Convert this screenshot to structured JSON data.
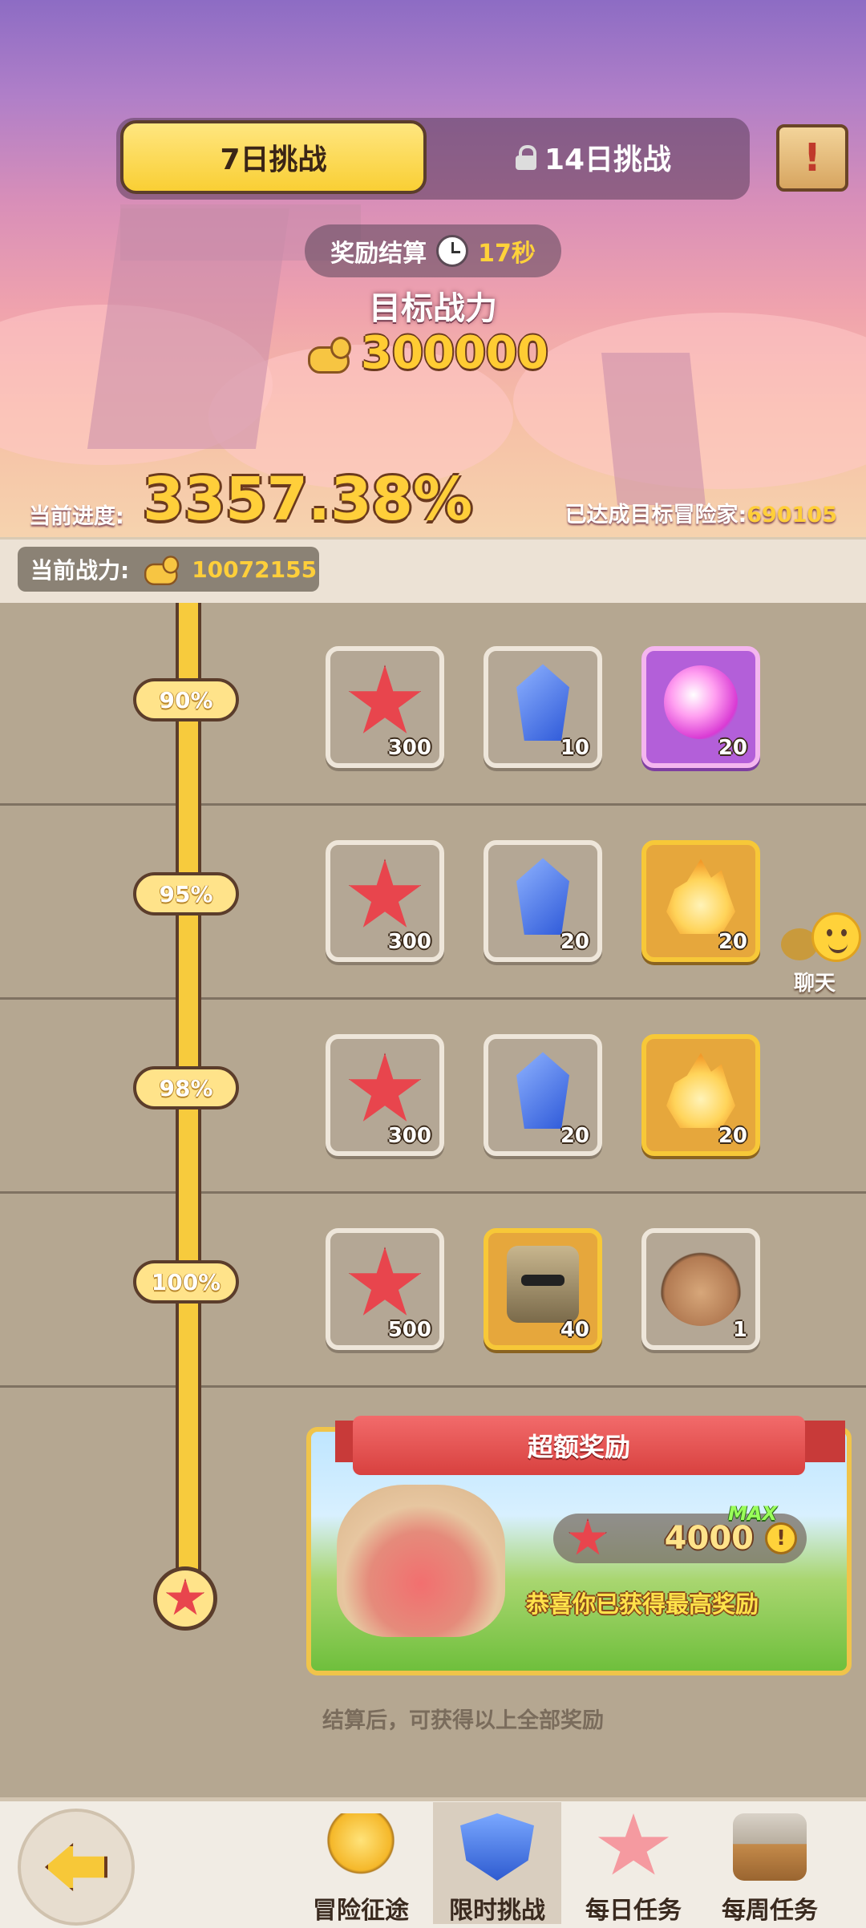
{
  "header": {
    "tabs": [
      {
        "label": "7日挑战",
        "active": true,
        "locked": false
      },
      {
        "label": "14日挑战",
        "active": false,
        "locked": true
      }
    ],
    "rules_icon": "scroll-exclamation-icon",
    "settlement": {
      "label": "奖励结算",
      "timer": "17秒"
    },
    "target": {
      "title": "目标战力",
      "value": "300000"
    },
    "progress": {
      "label": "当前进度:",
      "value": "3357.38%"
    },
    "achieved": {
      "label": "已达成目标冒险家:",
      "value": "690105"
    },
    "current_power": {
      "label": "当前战力:",
      "value": "10072155"
    }
  },
  "milestones": [
    {
      "percent": "90%",
      "rewards": [
        {
          "icon": "red-starfish-icon",
          "qty": "300",
          "rarity": "common"
        },
        {
          "icon": "blue-crystal-icon",
          "qty": "10",
          "rarity": "common"
        },
        {
          "icon": "pink-orb-icon",
          "qty": "20",
          "rarity": "epic"
        }
      ]
    },
    {
      "percent": "95%",
      "rewards": [
        {
          "icon": "red-starfish-icon",
          "qty": "300",
          "rarity": "common"
        },
        {
          "icon": "blue-crystal-icon",
          "qty": "20",
          "rarity": "common"
        },
        {
          "icon": "golden-flame-icon",
          "qty": "20",
          "rarity": "legendary"
        }
      ]
    },
    {
      "percent": "98%",
      "rewards": [
        {
          "icon": "red-starfish-icon",
          "qty": "300",
          "rarity": "common"
        },
        {
          "icon": "blue-crystal-icon",
          "qty": "20",
          "rarity": "common"
        },
        {
          "icon": "golden-flame-icon",
          "qty": "20",
          "rarity": "legendary"
        }
      ]
    },
    {
      "percent": "100%",
      "rewards": [
        {
          "icon": "red-starfish-icon",
          "qty": "500",
          "rarity": "common"
        },
        {
          "icon": "chef-hero-shard-icon",
          "qty": "40",
          "rarity": "legendary"
        },
        {
          "icon": "raccoon-avatar-icon",
          "qty": "1",
          "rarity": "common"
        }
      ]
    }
  ],
  "chat": {
    "label": "聊天"
  },
  "bonus": {
    "title": "超额奖励",
    "value": "4000",
    "max_tag": "MAX",
    "message": "恭喜你已获得最高奖励"
  },
  "footnote": "结算后，可获得以上全部奖励",
  "nav": {
    "items": [
      {
        "label": "冒险征途",
        "icon": "trophy-icon",
        "active": false
      },
      {
        "label": "限时挑战",
        "icon": "star-shield-icon",
        "active": true
      },
      {
        "label": "每日任务",
        "icon": "starfish-icon",
        "active": false
      },
      {
        "label": "每周任务",
        "icon": "treasure-chest-icon",
        "active": false
      }
    ]
  },
  "colors": {
    "accent_gold": "#f9cf34",
    "progress_text": "#ffcf3a",
    "reward_red": "#e8454d"
  }
}
